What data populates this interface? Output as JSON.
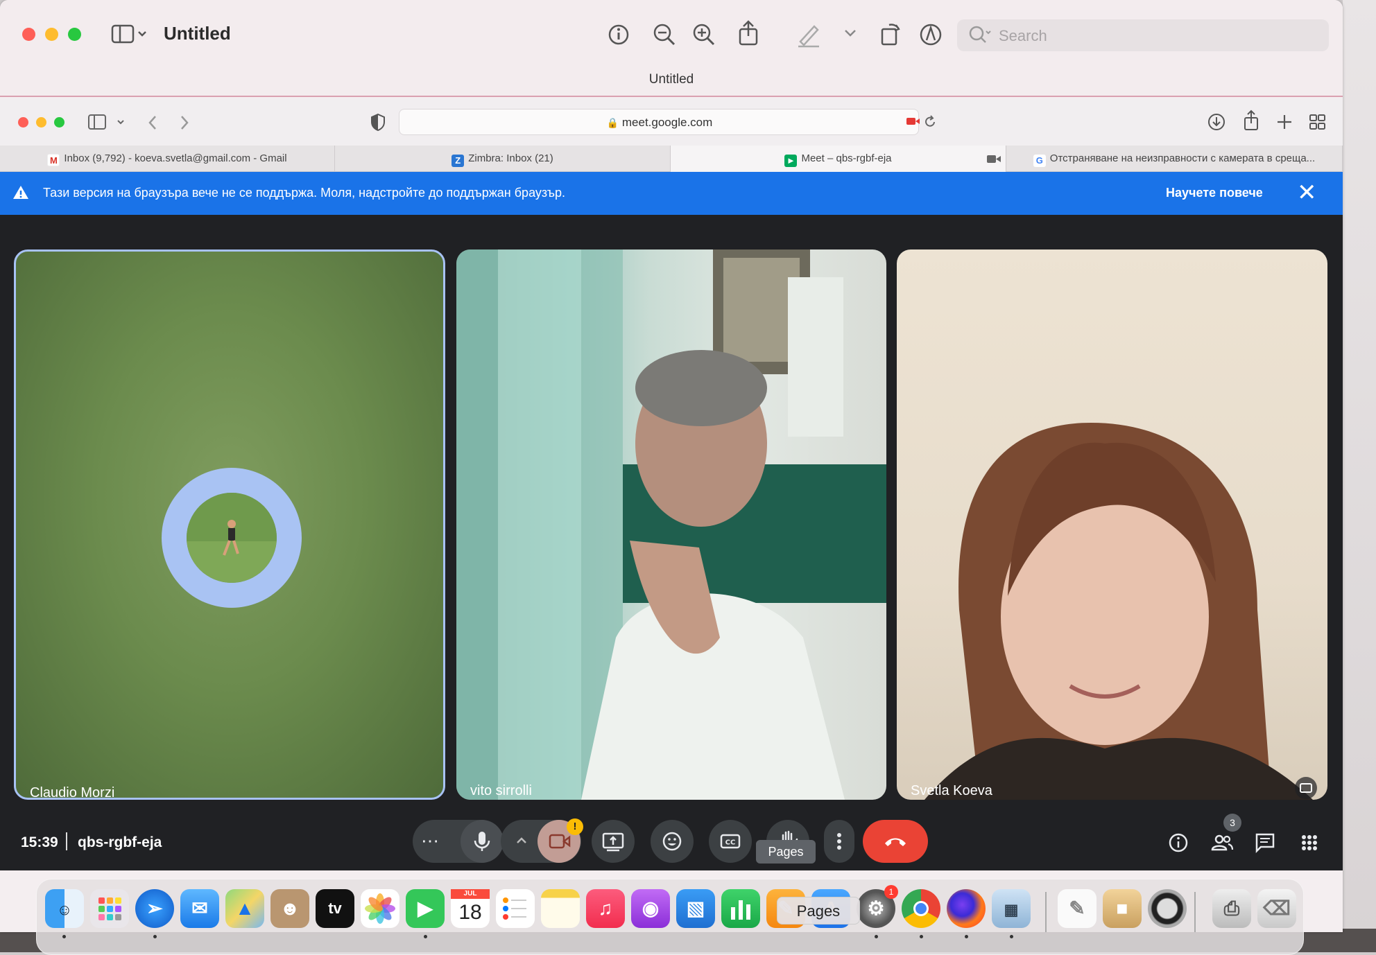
{
  "preview": {
    "title": "Untitled",
    "subtitle": "Untitled",
    "search_placeholder": "Search"
  },
  "safari": {
    "url": "meet.google.com",
    "tabs": [
      {
        "label": "Inbox (9,792) - koeva.svetla@gmail.com - Gmail",
        "favicon": "gmail-icon"
      },
      {
        "label": "Zimbra: Inbox (21)",
        "favicon": "zimbra-icon"
      },
      {
        "label": "Meet – qbs-rgbf-eja",
        "favicon": "meet-icon"
      },
      {
        "label": "Отстраняване на неизправности с камерата в среща...",
        "favicon": "google-icon"
      }
    ]
  },
  "banner": {
    "message": "Тази версия на браузъра вече не се поддържа. Моля, надстройте до поддържан браузър.",
    "link": "Научете повече"
  },
  "participants": [
    {
      "name": "Claudio Morzi"
    },
    {
      "name": "vito sirrolli"
    },
    {
      "name": "Svetla Koeva"
    }
  ],
  "meeting": {
    "time": "15:39",
    "code": "qbs-rgbf-eja",
    "camera_badge": "!",
    "people_count": "3",
    "raise_hand_tooltip": "Pages"
  },
  "dock": {
    "tooltip": "Pages",
    "calendar_month": "JUL",
    "calendar_day": "18",
    "settings_badge": "1",
    "apps": [
      "finder-icon",
      "launchpad-icon",
      "safari-icon",
      "mail-icon",
      "maps-icon",
      "contacts-icon",
      "apple-tv-icon",
      "photos-icon",
      "facetime-icon",
      "calendar-icon",
      "reminders-icon",
      "notes-icon",
      "music-icon",
      "podcasts-icon",
      "keynote-icon",
      "numbers-icon",
      "pages-icon",
      "app-store-icon",
      "system-settings-icon",
      "chrome-icon",
      "firefox-icon",
      "preview-icon",
      "textedit-icon",
      "archive-icon",
      "quicktime-icon",
      "scanner-icon",
      "trash-icon"
    ]
  },
  "colors": {
    "banner_blue": "#1a73e8",
    "hangup_red": "#ea4335",
    "meet_bg": "#202124",
    "active_ring": "#a8c2f5"
  }
}
